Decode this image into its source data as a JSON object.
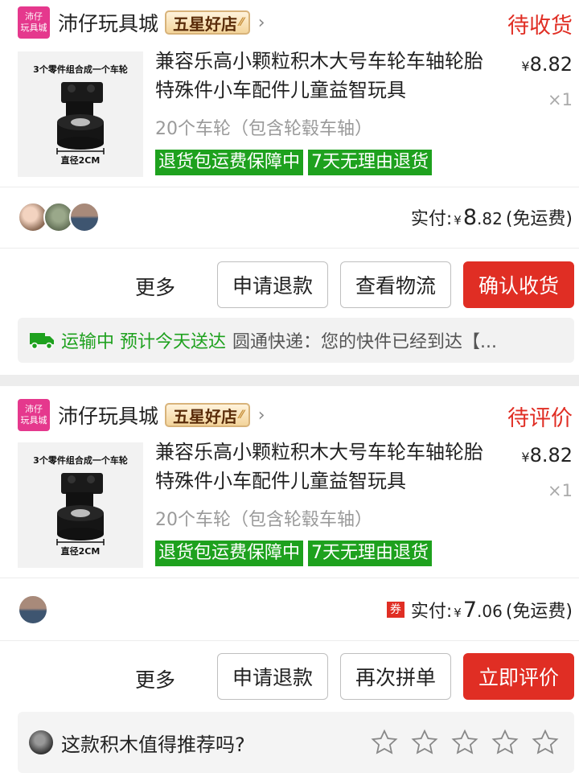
{
  "orders": [
    {
      "shop": {
        "logo_line1": "沛仔",
        "logo_line2": "玩具城",
        "name": "沛仔玩具城",
        "badge": "五星好店",
        "chevron": "›"
      },
      "status": "待收货",
      "product": {
        "image_caption": "3个零件组合成一个车轮",
        "image_diameter": "直径2CM",
        "title": "兼容乐高小颗粒积木大号车轮车轴轮胎特殊件小车配件儿童益智玩具",
        "spec": "20个车轮（包含轮毂车轴）",
        "tags": [
          "退货包运费保障中",
          "7天无理由退货"
        ],
        "price_symbol": "¥",
        "price": "8.82",
        "qty": "×1"
      },
      "paid": {
        "label": "实付:",
        "yen": "¥",
        "int": "8",
        "dec": ".82",
        "note": "(免运费)"
      },
      "actions": {
        "more": "更多",
        "refund": "申请退款",
        "logistics": "查看物流",
        "confirm": "确认收货"
      },
      "logistics": {
        "status": "运输中 预计今天送达",
        "detail": "圆通快递：您的快件已经到达【..."
      }
    },
    {
      "shop": {
        "logo_line1": "沛仔",
        "logo_line2": "玩具城",
        "name": "沛仔玩具城",
        "badge": "五星好店",
        "chevron": "›"
      },
      "status": "待评价",
      "product": {
        "image_caption": "3个零件组合成一个车轮",
        "image_diameter": "直径2CM",
        "title": "兼容乐高小颗粒积木大号车轮车轴轮胎特殊件小车配件儿童益智玩具",
        "spec": "20个车轮（包含轮毂车轴）",
        "tags": [
          "退货包运费保障中",
          "7天无理由退货"
        ],
        "price_symbol": "¥",
        "price": "8.82",
        "qty": "×1"
      },
      "paid": {
        "coupon": "券",
        "label": "实付:",
        "yen": "¥",
        "int": "7",
        "dec": ".06",
        "note": "(免运费)"
      },
      "actions": {
        "more": "更多",
        "refund": "申请退款",
        "rebuy": "再次拼单",
        "review": "立即评价"
      },
      "review": {
        "question": "这款积木值得推荐吗?"
      }
    }
  ],
  "colors": {
    "accent_red": "#e02e24",
    "tag_green": "#1ea11e",
    "shop_pink": "#e5388d"
  }
}
